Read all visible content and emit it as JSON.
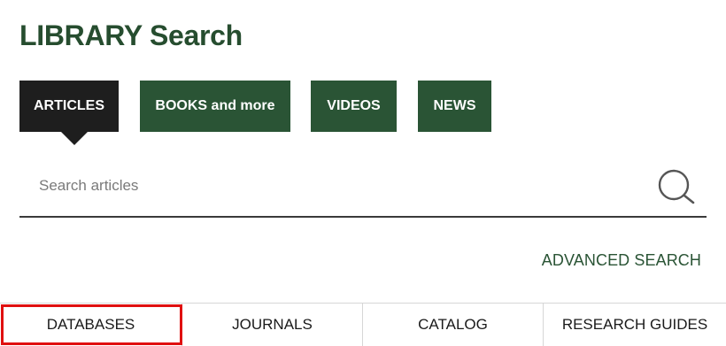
{
  "header": {
    "title": "LIBRARY Search"
  },
  "tabs": [
    {
      "label": "ARTICLES",
      "active": true
    },
    {
      "label": "BOOKS and more",
      "active": false
    },
    {
      "label": "VIDEOS",
      "active": false
    },
    {
      "label": "NEWS",
      "active": false
    }
  ],
  "search": {
    "placeholder": "Search articles",
    "value": "",
    "icon": "search-icon"
  },
  "advanced_search": {
    "label": "ADVANCED SEARCH"
  },
  "bottom_nav": [
    {
      "label": "DATABASES",
      "highlighted": true
    },
    {
      "label": "JOURNALS",
      "highlighted": false
    },
    {
      "label": "CATALOG",
      "highlighted": false
    },
    {
      "label": "RESEARCH GUIDES",
      "highlighted": false
    }
  ],
  "colors": {
    "brand_green": "#2a5435",
    "title_green": "#264d2f",
    "active_tab": "#1e1e1e",
    "highlight_red": "#e01010"
  }
}
